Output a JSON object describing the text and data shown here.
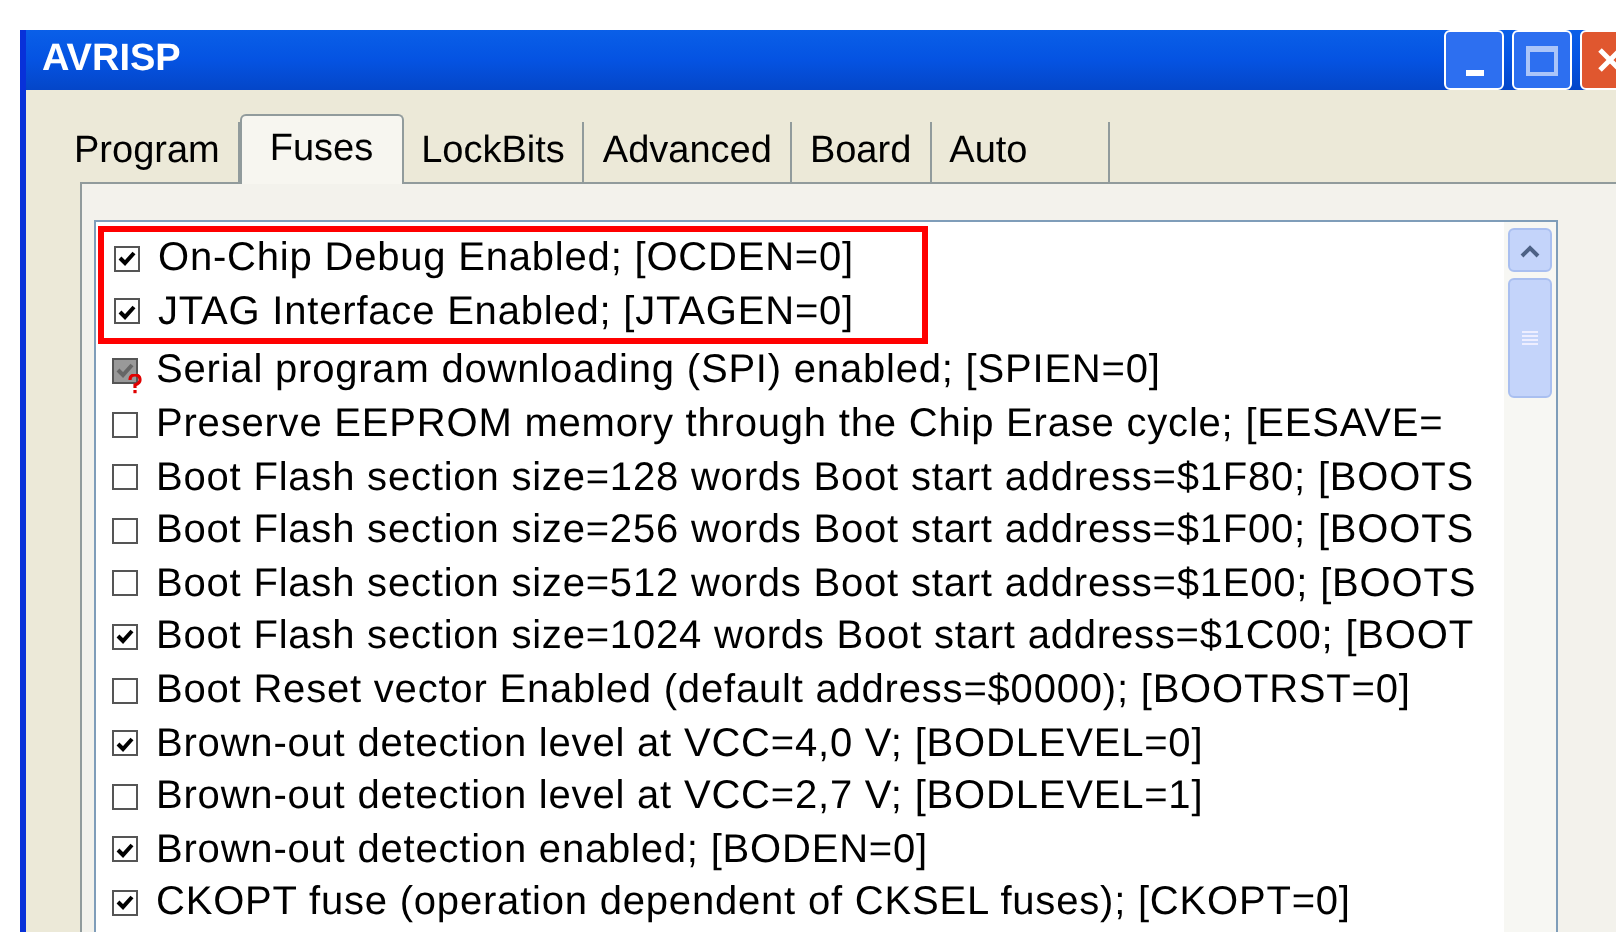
{
  "window": {
    "title": "AVRISP"
  },
  "tabs": [
    {
      "label": "Program",
      "selected": false
    },
    {
      "label": "Fuses",
      "selected": true
    },
    {
      "label": "LockBits",
      "selected": false
    },
    {
      "label": "Advanced",
      "selected": false
    },
    {
      "label": "Board",
      "selected": false
    },
    {
      "label": "Auto",
      "selected": false
    }
  ],
  "fuses": [
    {
      "label": "On-Chip Debug Enabled; [OCDEN=0]",
      "checked": true,
      "disabled": false,
      "highlighted": true
    },
    {
      "label": "JTAG Interface Enabled; [JTAGEN=0]",
      "checked": true,
      "disabled": false,
      "highlighted": true
    },
    {
      "label": "Serial program downloading (SPI) enabled; [SPIEN=0]",
      "checked": true,
      "disabled": true,
      "highlighted": false
    },
    {
      "label": "Preserve EEPROM memory through the Chip Erase cycle; [EESAVE=",
      "checked": false,
      "disabled": false,
      "highlighted": false
    },
    {
      "label": "Boot Flash section size=128 words Boot start address=$1F80; [BOOTS",
      "checked": false,
      "disabled": false,
      "highlighted": false
    },
    {
      "label": "Boot Flash section size=256 words Boot start address=$1F00; [BOOTS",
      "checked": false,
      "disabled": false,
      "highlighted": false
    },
    {
      "label": "Boot Flash section size=512 words Boot start address=$1E00; [BOOTS",
      "checked": false,
      "disabled": false,
      "highlighted": false
    },
    {
      "label": "Boot Flash section size=1024 words Boot start address=$1C00; [BOOT",
      "checked": true,
      "disabled": false,
      "highlighted": false
    },
    {
      "label": "Boot Reset vector Enabled (default address=$0000); [BOOTRST=0]",
      "checked": false,
      "disabled": false,
      "highlighted": false
    },
    {
      "label": "Brown-out detection level at VCC=4,0 V; [BODLEVEL=0]",
      "checked": true,
      "disabled": false,
      "highlighted": false
    },
    {
      "label": "Brown-out detection level at VCC=2,7 V; [BODLEVEL=1]",
      "checked": false,
      "disabled": false,
      "highlighted": false
    },
    {
      "label": "Brown-out detection enabled; [BODEN=0]",
      "checked": true,
      "disabled": false,
      "highlighted": false
    },
    {
      "label": "CKOPT fuse (operation dependent of CKSEL fuses); [CKOPT=0]",
      "checked": true,
      "disabled": false,
      "highlighted": false
    }
  ]
}
